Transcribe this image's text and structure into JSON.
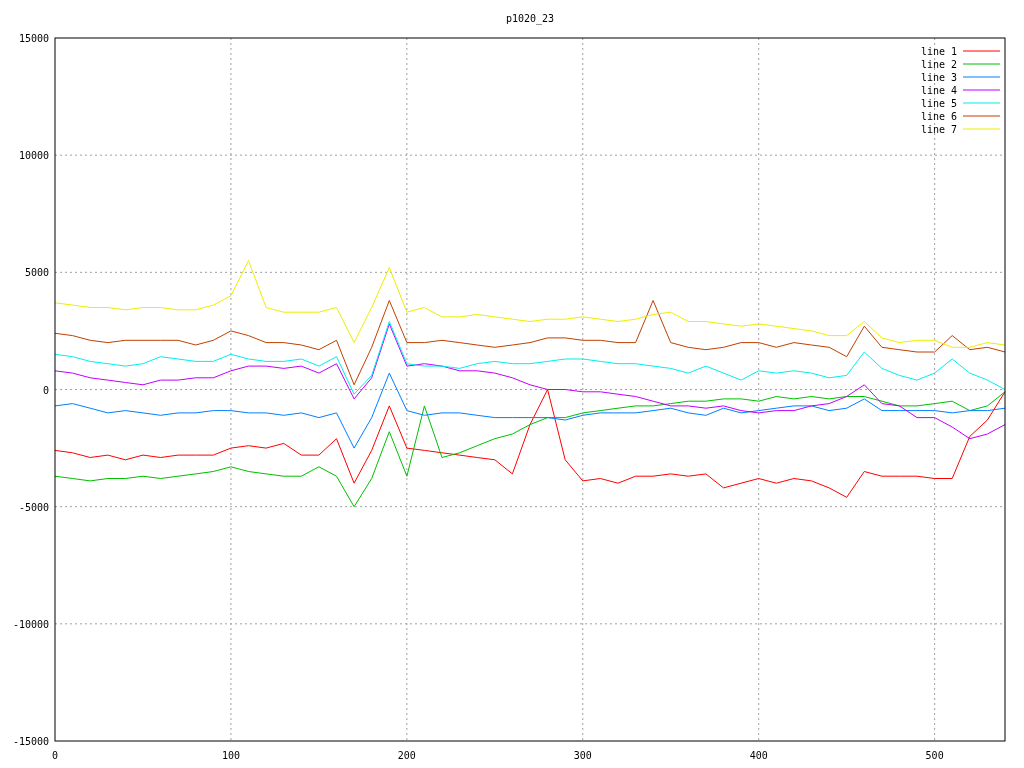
{
  "chart": {
    "chart_data": {
      "type": "line",
      "title": "p1020_23",
      "x": [
        0,
        10,
        20,
        30,
        40,
        50,
        60,
        70,
        80,
        90,
        100,
        110,
        120,
        130,
        140,
        150,
        160,
        170,
        180,
        190,
        200,
        210,
        220,
        230,
        240,
        250,
        260,
        270,
        280,
        290,
        300,
        310,
        320,
        330,
        340,
        350,
        360,
        370,
        380,
        390,
        400,
        410,
        420,
        430,
        440,
        450,
        460,
        470,
        480,
        490,
        500,
        510,
        520,
        530,
        540
      ],
      "grid": true,
      "legend": true,
      "xlim": [
        0,
        540
      ],
      "ylim": [
        -15000,
        15000
      ],
      "xticks": [
        0,
        100,
        200,
        300,
        400,
        500
      ],
      "yticks": [
        -15000,
        -10000,
        -5000,
        0,
        5000,
        10000,
        15000
      ],
      "series": [
        {
          "name": "line 1",
          "color": "#ff0000",
          "values": [
            -2600,
            -2700,
            -2900,
            -2800,
            -3000,
            -2800,
            -2900,
            -2800,
            -2800,
            -2800,
            -2500,
            -2400,
            -2500,
            -2300,
            -2800,
            -2800,
            -2100,
            -4000,
            -2600,
            -700,
            -2500,
            -2600,
            -2700,
            -2800,
            -2900,
            -3000,
            -3600,
            -1500,
            0,
            -3000,
            -3900,
            -3800,
            -4000,
            -3700,
            -3700,
            -3600,
            -3700,
            -3600,
            -4200,
            -4000,
            -3800,
            -4000,
            -3800,
            -3900,
            -4200,
            -4600,
            -3500,
            -3700,
            -3700,
            -3700,
            -3800,
            -3800,
            -2000,
            -1300,
            -100
          ]
        },
        {
          "name": "line 2",
          "color": "#00c000",
          "values": [
            -3700,
            -3800,
            -3900,
            -3800,
            -3800,
            -3700,
            -3800,
            -3700,
            -3600,
            -3500,
            -3300,
            -3500,
            -3600,
            -3700,
            -3700,
            -3300,
            -3700,
            -5000,
            -3800,
            -1800,
            -3700,
            -700,
            -2900,
            -2700,
            -2400,
            -2100,
            -1900,
            -1500,
            -1200,
            -1200,
            -1000,
            -900,
            -800,
            -700,
            -700,
            -600,
            -500,
            -500,
            -400,
            -400,
            -500,
            -300,
            -400,
            -300,
            -400,
            -300,
            -300,
            -500,
            -700,
            -700,
            -600,
            -500,
            -900,
            -700,
            -100
          ]
        },
        {
          "name": "line 3",
          "color": "#0080ff",
          "values": [
            -700,
            -600,
            -800,
            -1000,
            -900,
            -1000,
            -1100,
            -1000,
            -1000,
            -900,
            -900,
            -1000,
            -1000,
            -1100,
            -1000,
            -1200,
            -1000,
            -2500,
            -1200,
            700,
            -900,
            -1100,
            -1000,
            -1000,
            -1100,
            -1200,
            -1200,
            -1200,
            -1200,
            -1300,
            -1100,
            -1000,
            -1000,
            -1000,
            -900,
            -800,
            -1000,
            -1100,
            -800,
            -1000,
            -900,
            -800,
            -700,
            -700,
            -900,
            -800,
            -400,
            -900,
            -900,
            -900,
            -900,
            -1000,
            -900,
            -900,
            -800
          ]
        },
        {
          "name": "line 4",
          "color": "#c000ff",
          "values": [
            800,
            700,
            500,
            400,
            300,
            200,
            400,
            400,
            500,
            500,
            800,
            1000,
            1000,
            900,
            1000,
            700,
            1100,
            -400,
            500,
            2800,
            1000,
            1100,
            1000,
            800,
            800,
            700,
            500,
            200,
            0,
            0,
            -100,
            -100,
            -200,
            -300,
            -500,
            -700,
            -700,
            -800,
            -700,
            -900,
            -1000,
            -900,
            -900,
            -700,
            -600,
            -300,
            200,
            -600,
            -700,
            -1200,
            -1200,
            -1600,
            -2100,
            -1900,
            -1500
          ]
        },
        {
          "name": "line 5",
          "color": "#00eeee",
          "values": [
            1500,
            1400,
            1200,
            1100,
            1000,
            1100,
            1400,
            1300,
            1200,
            1200,
            1500,
            1300,
            1200,
            1200,
            1300,
            1000,
            1400,
            -200,
            600,
            2900,
            1100,
            1000,
            1000,
            900,
            1100,
            1200,
            1100,
            1100,
            1200,
            1300,
            1300,
            1200,
            1100,
            1100,
            1000,
            900,
            700,
            1000,
            700,
            400,
            800,
            700,
            800,
            700,
            500,
            600,
            1600,
            900,
            600,
            400,
            700,
            1300,
            700,
            400,
            0
          ]
        },
        {
          "name": "line 6",
          "color": "#c04000",
          "values": [
            2400,
            2300,
            2100,
            2000,
            2100,
            2100,
            2100,
            2100,
            1900,
            2100,
            2500,
            2300,
            2000,
            2000,
            1900,
            1700,
            2100,
            200,
            1800,
            3800,
            2000,
            2000,
            2100,
            2000,
            1900,
            1800,
            1900,
            2000,
            2200,
            2200,
            2100,
            2100,
            2000,
            2000,
            3800,
            2000,
            1800,
            1700,
            1800,
            2000,
            2000,
            1800,
            2000,
            1900,
            1800,
            1400,
            2700,
            1800,
            1700,
            1600,
            1600,
            2300,
            1700,
            1800,
            1600
          ]
        },
        {
          "name": "line 7",
          "color": "#eeee00",
          "values": [
            3700,
            3600,
            3500,
            3500,
            3400,
            3500,
            3500,
            3400,
            3400,
            3600,
            4000,
            5500,
            3500,
            3300,
            3300,
            3300,
            3500,
            2000,
            3500,
            5200,
            3300,
            3500,
            3100,
            3100,
            3200,
            3100,
            3000,
            2900,
            3000,
            3000,
            3100,
            3000,
            2900,
            3000,
            3200,
            3300,
            2900,
            2900,
            2800,
            2700,
            2800,
            2700,
            2600,
            2500,
            2300,
            2300,
            2900,
            2200,
            2000,
            2100,
            2100,
            1800,
            1800,
            2000,
            1900
          ]
        }
      ]
    }
  }
}
